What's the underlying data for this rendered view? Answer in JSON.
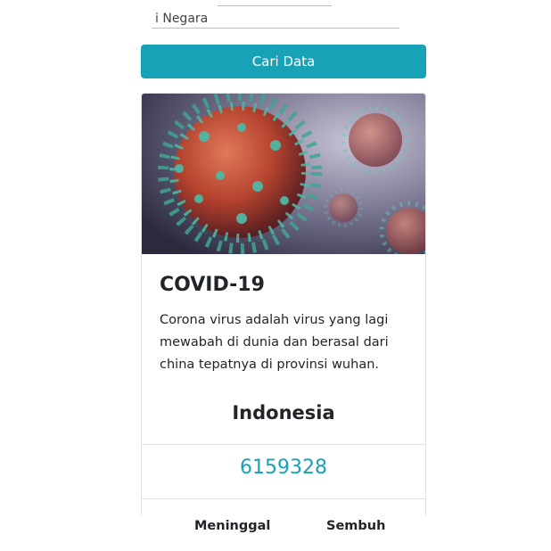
{
  "search": {
    "value": "i Negara",
    "button_label": "Cari Data"
  },
  "card": {
    "title": "COVID-19",
    "text": "Corona virus adalah virus yang lagi mewabah di dunia dan berasal dari china tepatnya di provinsi wuhan.",
    "country": "Indonesia",
    "count": "6159328"
  },
  "stats": {
    "death_label": "Meninggal",
    "recovered_label": "Sembuh"
  },
  "colors": {
    "accent": "#17a2b8",
    "text": "#212529",
    "border": "#dee2e6"
  }
}
